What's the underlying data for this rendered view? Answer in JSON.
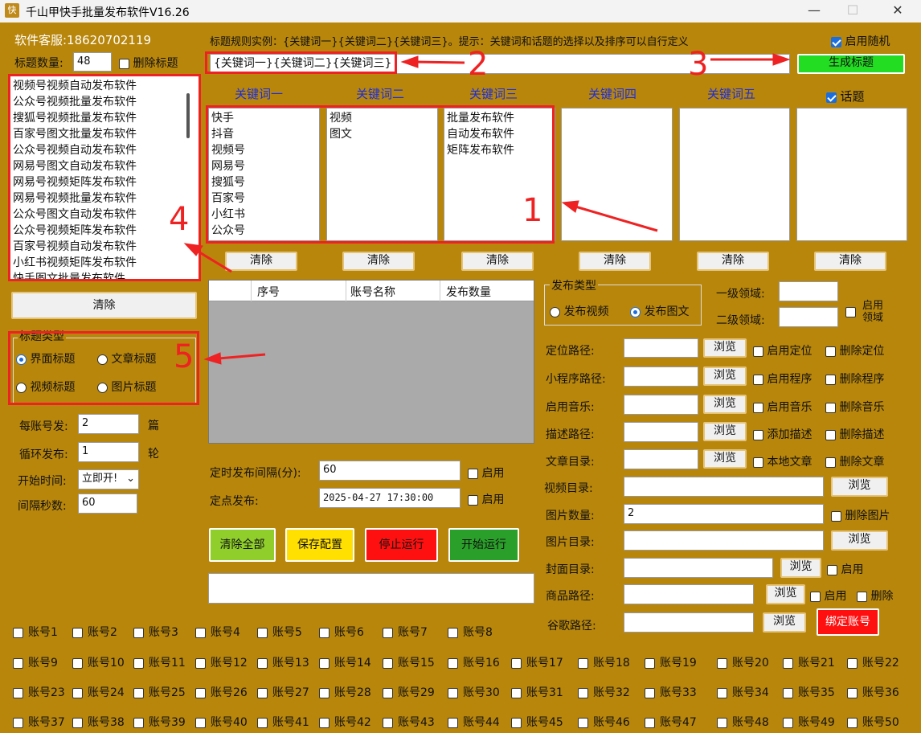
{
  "window": {
    "title": "千山甲快手批量发布软件V16.26",
    "icon_text": "快",
    "minimize": "—",
    "maximize": "☐",
    "close": "✕"
  },
  "support": "软件客服:18620702119",
  "title_count": {
    "label": "标题数量:",
    "value": "48",
    "delete_label": "删除标题"
  },
  "title_list": [
    "视频号视频自动发布软件",
    "公众号视频批量发布软件",
    "搜狐号视频批量发布软件",
    "百家号图文批量发布软件",
    "公众号视频自动发布软件",
    "网易号图文自动发布软件",
    "网易号视频矩阵发布软件",
    "网易号视频批量发布软件",
    "公众号图文自动发布软件",
    "公众号视频矩阵发布软件",
    "百家号视频自动发布软件",
    "小红书视频矩阵发布软件",
    "快手图文批量发布软件"
  ],
  "clear_label": "清除",
  "rule": {
    "text": "标题规则实例：{关键词一}{关键词二}{关键词三}。提示：关键词和话题的选择以及排序可以自行定义",
    "value": "{关键词一}{关键词二}{关键词三}",
    "enable_random": "启用随机",
    "generate": "生成标题"
  },
  "keywords": {
    "headers": [
      "关键词一",
      "关键词二",
      "关键词三",
      "关键词四",
      "关键词五"
    ],
    "topic_label": "话题",
    "col1": [
      "快手",
      "抖音",
      "视频号",
      "网易号",
      "搜狐号",
      "百家号",
      "小红书",
      "公众号"
    ],
    "col2": [
      "视频",
      "图文"
    ],
    "col3": [
      "批量发布软件",
      "自动发布软件",
      "矩阵发布软件"
    ]
  },
  "table": {
    "headers": [
      "序号",
      "账号名称",
      "发布数量"
    ]
  },
  "title_type": {
    "legend": "标题类型",
    "options": [
      "界面标题",
      "文章标题",
      "视频标题",
      "图片标题"
    ],
    "selected": "界面标题"
  },
  "per_account": {
    "label": "每账号发:",
    "value": "2",
    "unit": "篇"
  },
  "loop": {
    "label": "循环发布:",
    "value": "1",
    "unit": "轮"
  },
  "start_time": {
    "label": "开始时间:",
    "value": "立即开!"
  },
  "interval": {
    "label": "间隔秒数:",
    "value": "60"
  },
  "timed": {
    "label": "定时发布间隔(分):",
    "value": "60",
    "enable": "启用"
  },
  "fixed": {
    "label": "定点发布:",
    "value": "2025-04-27 17:30:00",
    "enable": "启用"
  },
  "actions": {
    "clear_all": "清除全部",
    "save": "保存配置",
    "stop": "停止运行",
    "start": "开始运行"
  },
  "publish_type": {
    "legend": "发布类型",
    "video": "发布视频",
    "image": "发布图文",
    "selected": "发布图文"
  },
  "domain": {
    "l1": "一级领域:",
    "l2": "二级领域:",
    "enable": "启用领域"
  },
  "paths": {
    "location": "定位路径:",
    "program": "小程序路径:",
    "music": "启用音乐:",
    "desc": "描述路径:",
    "article": "文章目录:",
    "video_dir": "视频目录:",
    "image_count": "图片数量:",
    "image_count_value": "2",
    "image_dir": "图片目录:",
    "cover": "封面目录:",
    "goods": "商品路径:",
    "google": "谷歌路径:"
  },
  "browse": "浏览",
  "opts": {
    "enable_location": "启用定位",
    "del_location": "删除定位",
    "enable_program": "启用程序",
    "del_program": "删除程序",
    "enable_music": "启用音乐",
    "del_music": "删除音乐",
    "add_desc": "添加描述",
    "del_desc": "删除描述",
    "local_article": "本地文章",
    "del_article": "删除文章",
    "del_image": "删除图片",
    "enable": "启用",
    "delete": "删除",
    "bind": "绑定账号"
  },
  "annotations": [
    "1",
    "2",
    "3",
    "4",
    "5"
  ],
  "accounts": [
    "账号1",
    "账号2",
    "账号3",
    "账号4",
    "账号5",
    "账号6",
    "账号7",
    "账号8",
    "账号9",
    "账号10",
    "账号11",
    "账号12",
    "账号13",
    "账号14",
    "账号15",
    "账号16",
    "账号17",
    "账号18",
    "账号19",
    "账号20",
    "账号21",
    "账号22",
    "账号23",
    "账号24",
    "账号25",
    "账号26",
    "账号27",
    "账号28",
    "账号29",
    "账号30",
    "账号31",
    "账号32",
    "账号33",
    "账号34",
    "账号35",
    "账号36",
    "账号37",
    "账号38",
    "账号39",
    "账号40",
    "账号41",
    "账号42",
    "账号43",
    "账号44",
    "账号45",
    "账号46",
    "账号47",
    "账号48",
    "账号49",
    "账号50"
  ],
  "colors": {
    "bg": "#b8860b",
    "generate": "#22dd22",
    "clear_all": "#8fce2b",
    "save": "#ffe000",
    "stop": "#ff1010",
    "start": "#2aa02a",
    "bind": "#ff1010",
    "annotation": "#ee2222"
  }
}
